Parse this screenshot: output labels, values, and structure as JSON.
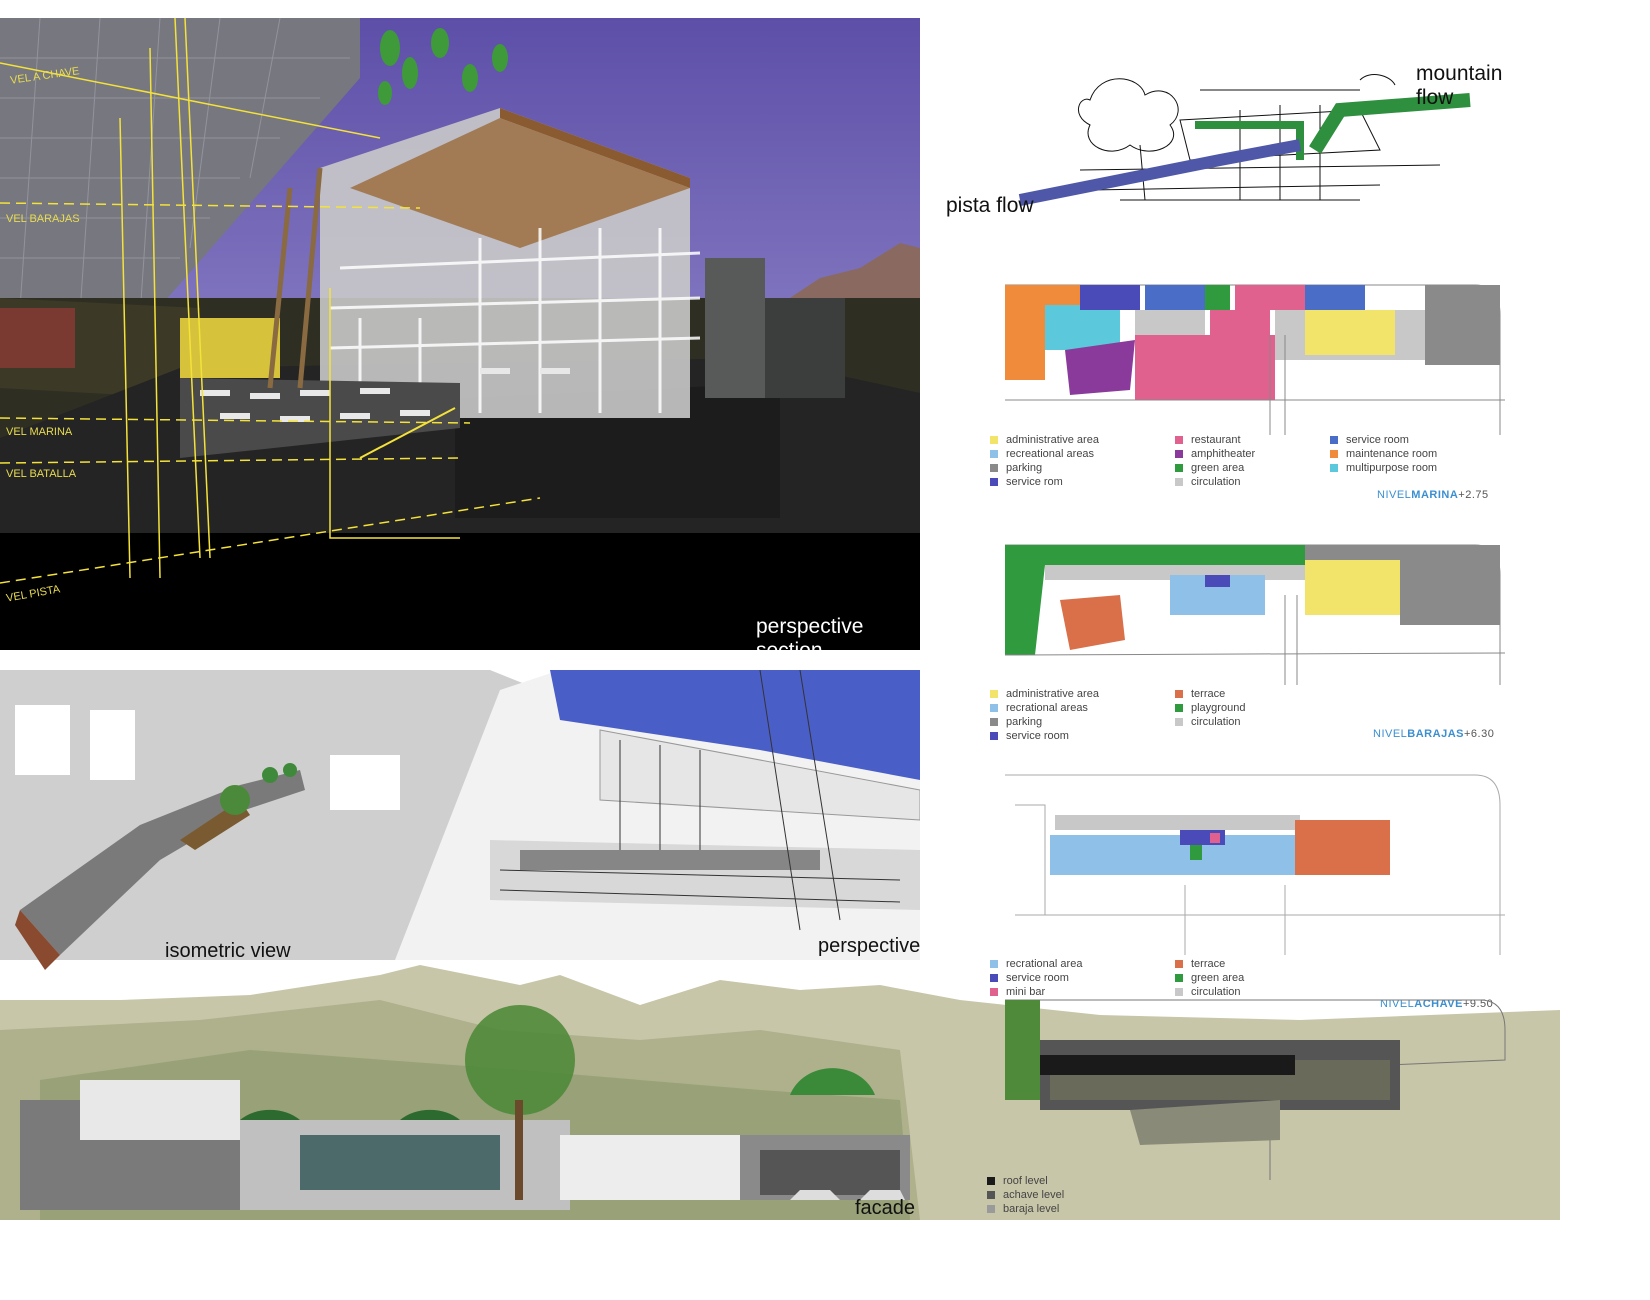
{
  "captions": {
    "perspective_section": "perspective section",
    "isometric_view": "isometric view",
    "perspective": "perspective",
    "facade": "facade"
  },
  "section_levels": [
    "VEL A CHAVE",
    "VEL BARAJAS",
    "VEL MARINA",
    "VEL BATALLA",
    "VEL PISTA"
  ],
  "sketch": {
    "mountain_flow": "mountain flow",
    "pista_flow": "pista flow"
  },
  "plans": [
    {
      "level_prefix": "NIVEL",
      "level_name": "MARINA",
      "level_value": "+2.75",
      "legend_columns": [
        [
          {
            "label": "administrative area",
            "color": "#f2e36b"
          },
          {
            "label": "recreational areas",
            "color": "#8fc0e8"
          },
          {
            "label": "parking",
            "color": "#8a8a8a"
          },
          {
            "label": "service rom",
            "color": "#4a4ab8"
          }
        ],
        [
          {
            "label": "restaurant",
            "color": "#e0608e"
          },
          {
            "label": "amphitheater",
            "color": "#8a3a9a"
          },
          {
            "label": "green area",
            "color": "#2f9a3e"
          },
          {
            "label": "circulation",
            "color": "#c8c8c8"
          }
        ],
        [
          {
            "label": "service room",
            "color": "#4a6ec8"
          },
          {
            "label": "maintenance room",
            "color": "#ef8b3a"
          },
          {
            "label": "multipurpose room",
            "color": "#5cc8dc"
          }
        ]
      ]
    },
    {
      "level_prefix": "NIVEL",
      "level_name": "BARAJAS",
      "level_value": "+6.30",
      "legend_columns": [
        [
          {
            "label": "administrative area",
            "color": "#f2e36b"
          },
          {
            "label": "recrational areas",
            "color": "#8fc0e8"
          },
          {
            "label": "parking",
            "color": "#8a8a8a"
          },
          {
            "label": "service room",
            "color": "#4a4ab8"
          }
        ],
        [
          {
            "label": "terrace",
            "color": "#d9704a"
          },
          {
            "label": "playground",
            "color": "#2f9a3e"
          },
          {
            "label": "circulation",
            "color": "#c8c8c8"
          }
        ]
      ]
    },
    {
      "level_prefix": "NIVEL",
      "level_name": "ACHAVE",
      "level_value": "+9.50",
      "legend_columns": [
        [
          {
            "label": "recrational area",
            "color": "#8fc0e8"
          },
          {
            "label": "service room",
            "color": "#4a4ab8"
          },
          {
            "label": "mini bar",
            "color": "#e0608e"
          }
        ],
        [
          {
            "label": "terrace",
            "color": "#d9704a"
          },
          {
            "label": "green area",
            "color": "#2f9a3e"
          },
          {
            "label": "circulation",
            "color": "#c8c8c8"
          }
        ]
      ]
    }
  ],
  "roof_legend": [
    {
      "label": "roof level",
      "color": "#1a1a1a"
    },
    {
      "label": "achave level",
      "color": "#555555"
    },
    {
      "label": "baraja level",
      "color": "#9a9a9a"
    }
  ]
}
